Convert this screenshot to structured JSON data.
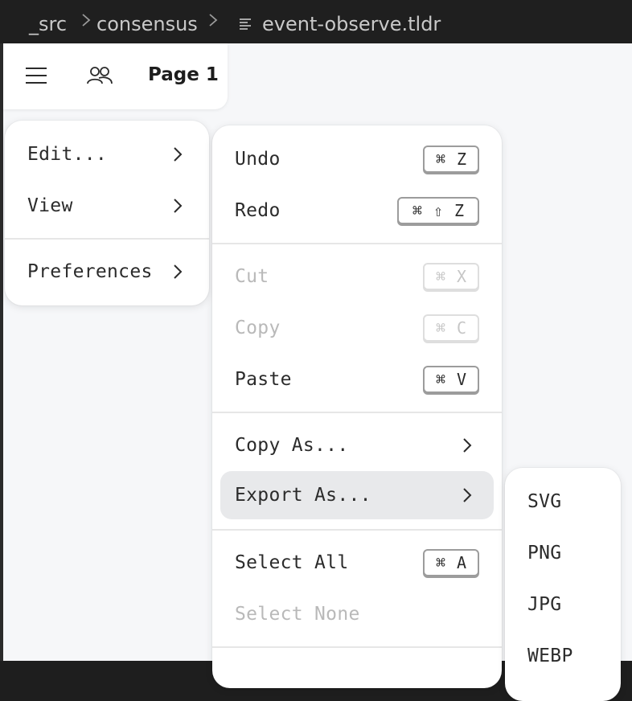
{
  "breadcrumb": {
    "segments": [
      "_src",
      "consensus",
      "event-observe.tldr"
    ],
    "file_icon": "file-text-icon"
  },
  "topbar": {
    "menu_icon": "hamburger-menu-icon",
    "people_icon": "people-icon",
    "page_label": "Page 1"
  },
  "main_menu": {
    "items": [
      {
        "label": "Edit..."
      },
      {
        "label": "View"
      },
      {
        "label": "Preferences"
      }
    ]
  },
  "edit_menu": {
    "items": [
      {
        "label": "Undo",
        "shortcut": [
          "⌘",
          "Z"
        ]
      },
      {
        "label": "Redo",
        "shortcut": [
          "⌘",
          "⇧",
          "Z"
        ]
      },
      {
        "label": "Cut",
        "shortcut": [
          "⌘",
          "X"
        ],
        "disabled": true
      },
      {
        "label": "Copy",
        "shortcut": [
          "⌘",
          "C"
        ],
        "disabled": true
      },
      {
        "label": "Paste",
        "shortcut": [
          "⌘",
          "V"
        ]
      },
      {
        "label": "Copy As..."
      },
      {
        "label": "Export As...",
        "highlighted": true
      },
      {
        "label": "Select All",
        "shortcut": [
          "⌘",
          "A"
        ]
      },
      {
        "label": "Select None",
        "disabled": true
      }
    ]
  },
  "export_menu": {
    "items": [
      {
        "label": "SVG"
      },
      {
        "label": "PNG"
      },
      {
        "label": "JPG"
      },
      {
        "label": "WEBP"
      }
    ]
  }
}
